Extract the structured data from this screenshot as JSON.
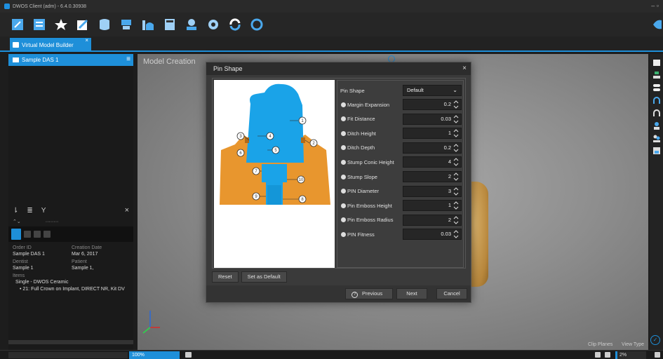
{
  "app": {
    "title": "DWOS Client (adm) - 6.4.0.30938",
    "accent": "#1e8fd9"
  },
  "toolbar": {
    "icons": [
      "new-order-icon",
      "order-list-icon",
      "favorite-icon",
      "edit-icon",
      "scan-icon",
      "model-icon",
      "design-icon",
      "calculator-icon",
      "users-icon",
      "settings-icon",
      "sync-icon",
      "help-icon"
    ]
  },
  "tab": {
    "label": "Virtual Model Builder"
  },
  "left_panel": {
    "header": "Sample DAS 1",
    "order_id_label": "Order ID",
    "order_id": "Sample DAS 1",
    "creation_date_label": "Creation Date",
    "creation_date": "Mar 6, 2017",
    "dentist_label": "Dentist",
    "dentist": "Sample 1",
    "patient_label": "Patient",
    "patient": "Sample 1,",
    "items_label": "Items",
    "item_1": "Single - DWOS Ceramic",
    "item_2": "• 21: Full Crown on Implant, DIRECT NR, Kit DV"
  },
  "viewport": {
    "title": "Model Creation",
    "clip_planes": "Clip Planes",
    "view_type": "View Type"
  },
  "dialog": {
    "title": "Pin Shape",
    "pin_shape_label": "Pin Shape",
    "pin_shape_value": "Default",
    "params": [
      {
        "label": "Margin Expansion",
        "value": "0.2"
      },
      {
        "label": "Fit Distance",
        "value": "0.03"
      },
      {
        "label": "Ditch Height",
        "value": "1"
      },
      {
        "label": "Ditch Depth",
        "value": "0.2"
      },
      {
        "label": "Stump Conic Height",
        "value": "4"
      },
      {
        "label": "Stump Slope",
        "value": "2"
      },
      {
        "label": "PIN Diameter",
        "value": "3"
      },
      {
        "label": "Pin Emboss Height",
        "value": "1"
      },
      {
        "label": "Pin Emboss Radius",
        "value": "2"
      },
      {
        "label": "PIN Fitness",
        "value": "0.03"
      }
    ],
    "reset": "Reset",
    "set_default": "Set as Default",
    "previous": "Previous",
    "next": "Next",
    "cancel": "Cancel",
    "callouts": [
      "1",
      "2",
      "3",
      "4",
      "5",
      "6",
      "7",
      "8",
      "9",
      "10"
    ]
  },
  "status": {
    "progress": "100%",
    "progress_fraction": 1.0,
    "zoom": "2%",
    "zoom_fraction": 0.02
  }
}
